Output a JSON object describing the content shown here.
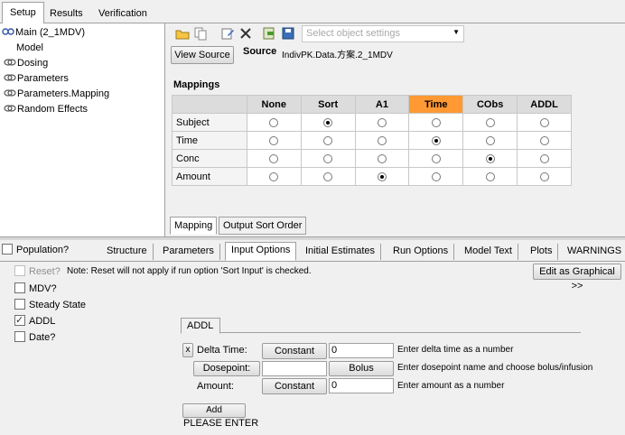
{
  "top_tabs": [
    "Setup",
    "Results",
    "Verification"
  ],
  "tree": {
    "items": [
      {
        "label": "Main (2_1MDV)",
        "icon": "model-icon"
      },
      {
        "label": "Model",
        "icon": ""
      },
      {
        "label": "Dosing",
        "icon": "link-icon"
      },
      {
        "label": "Parameters",
        "icon": "link-icon"
      },
      {
        "label": "Parameters.Mapping",
        "icon": "link-icon"
      },
      {
        "label": "Random Effects",
        "icon": "link-icon"
      }
    ]
  },
  "toolbar": {
    "combo_placeholder": "Select object settings"
  },
  "source": {
    "view_button": "View Source",
    "label": "Source",
    "value": "IndivPK.Data.方案.2_1MDV"
  },
  "mappings": {
    "title": "Mappings",
    "columns": [
      "None",
      "Sort",
      "A1",
      "Time",
      "CObs",
      "ADDL"
    ],
    "highlight_column": "Time",
    "rows": [
      {
        "label": "Subject",
        "selected": "Sort"
      },
      {
        "label": "Time",
        "selected": "Time"
      },
      {
        "label": "Conc",
        "selected": "CObs"
      },
      {
        "label": "Amount",
        "selected": "A1"
      }
    ]
  },
  "subtabs": [
    "Mapping",
    "Output Sort Order"
  ],
  "left_options": {
    "population": {
      "label": "Population?",
      "checked": false
    },
    "reset": {
      "label": "Reset?",
      "checked": false
    },
    "mdv": {
      "label": "MDV?",
      "checked": false
    },
    "steady_state": {
      "label": "Steady State",
      "checked": false
    },
    "addl": {
      "label": "ADDL",
      "checked": true
    },
    "date": {
      "label": "Date?",
      "checked": false
    }
  },
  "bottom_tabs": [
    "Structure",
    "Parameters",
    "Input Options",
    "Initial Estimates",
    "Run Options",
    "Model Text",
    "Plots",
    "WARNINGS"
  ],
  "note": "Note: Reset will not apply if run option 'Sort Input' is checked.",
  "edit_graphical_button": "Edit as Graphical >>",
  "addl_panel": {
    "tab": "ADDL",
    "x_button": "x",
    "delta_time_label": "Delta Time:",
    "delta_constant_btn": "Constant",
    "delta_value": "0",
    "delta_hint": "Enter delta time as a number",
    "dosepoint_button": "Dosepoint:",
    "dosepoint_value": "",
    "bolus_button": "Bolus",
    "dosepoint_hint": "Enter dosepoint name and choose bolus/infusion",
    "amount_label": "Amount:",
    "amount_constant_btn": "Constant",
    "amount_value": "0",
    "amount_hint": "Enter amount as a number",
    "add_button": "Add",
    "please_enter": "PLEASE ENTER"
  },
  "colors": {
    "highlight": "#ff9933",
    "header_gray": "#dcdcdc"
  }
}
